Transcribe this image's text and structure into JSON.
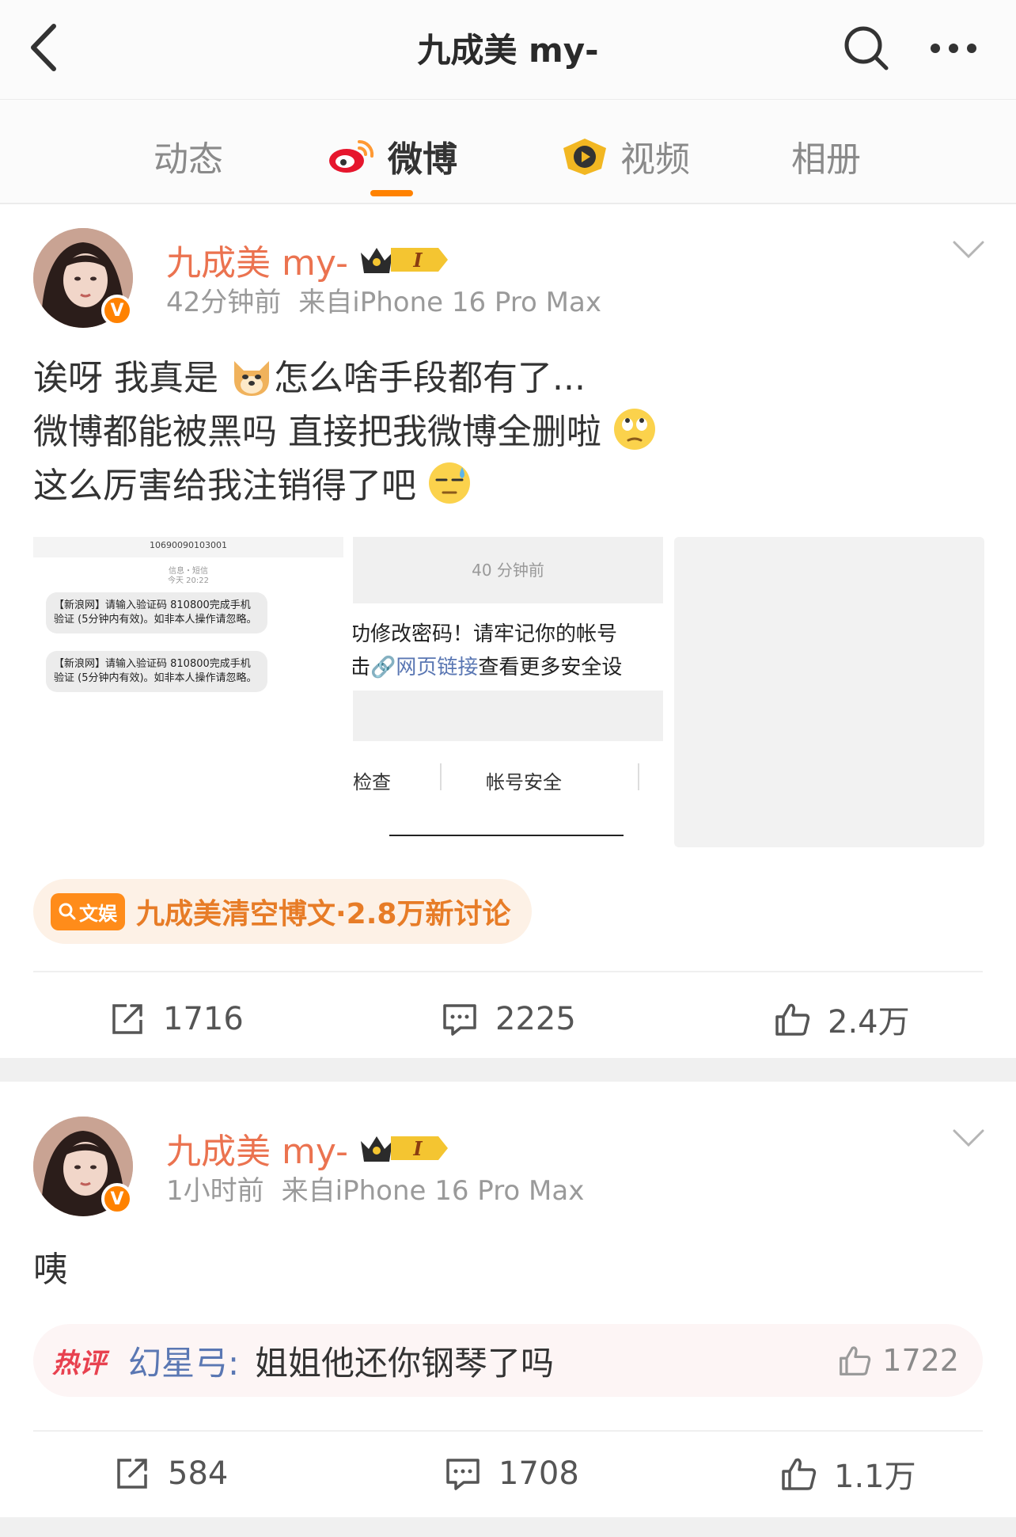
{
  "topbar": {
    "title": "九成美 my-"
  },
  "tabs": [
    "动态",
    "微博",
    "视频",
    "相册"
  ],
  "posts": [
    {
      "author": "九成美 my-",
      "verified": "V",
      "vip_level": "I",
      "time": "42分钟前",
      "source": "来自iPhone 16 Pro Max",
      "lines": [
        "诶呀 我真是",
        "怎么啥手段都有了...",
        "微博都能被黑吗 直接把我微博全删啦",
        "这么厉害给我注销得了吧"
      ],
      "images": {
        "sms": {
          "sender": "10690090103001",
          "channel": "信息・短信",
          "day": "今天 20:22",
          "messages": [
            "【新浪网】请输入验证码 810800完成手机验证 (5分钟内有效)。如非本人操作请忽略。",
            "【新浪网】请输入验证码 810800完成手机验证 (5分钟内有效)。如非本人操作请忽略。"
          ]
        },
        "notice": {
          "time": "40 分钟前",
          "line1": "功修改密码！请牢记你的帐号",
          "line2_prefix": "击",
          "line2_link": "网页链接",
          "line2_suffix": "查看更多安全设",
          "btn_left": "检查",
          "btn_right": "帐号安全"
        }
      },
      "topic": {
        "tag": "文娱",
        "text": "九成美清空博文·2.8万新讨论"
      },
      "stats": {
        "reposts": "1716",
        "comments": "2225",
        "likes": "2.4万"
      }
    },
    {
      "author": "九成美 my-",
      "verified": "V",
      "vip_level": "I",
      "time": "1小时前",
      "source": "来自iPhone 16 Pro Max",
      "text": "咦",
      "hot_comment": {
        "tag": "热评",
        "user": "幻星弓:",
        "text": "姐姐他还你钢琴了吗",
        "likes": "1722"
      },
      "stats": {
        "reposts": "584",
        "comments": "1708",
        "likes": "1.1万"
      }
    }
  ],
  "colors": {
    "accent": "#ff8200",
    "author": "#eb7350",
    "link": "#5a77b3",
    "hot": "#e8414f"
  }
}
